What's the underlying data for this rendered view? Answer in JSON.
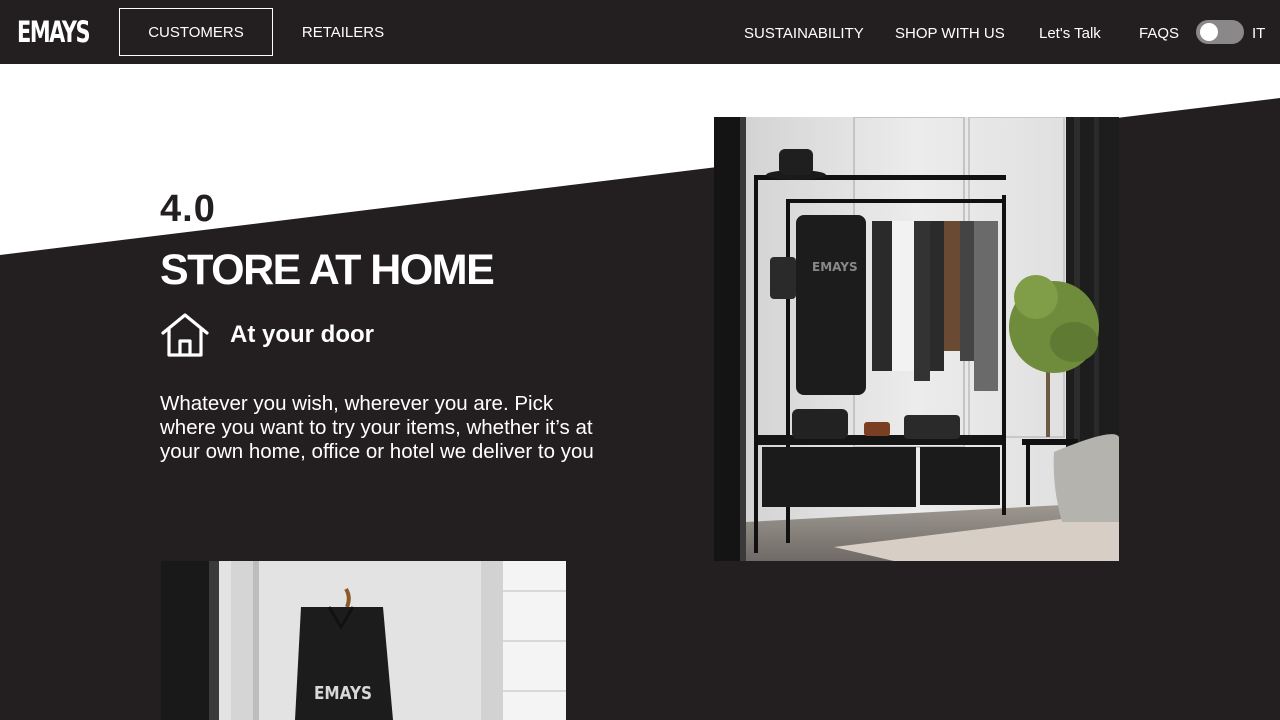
{
  "nav": {
    "logo": "EMAYS",
    "tabs": [
      {
        "label": "CUSTOMERS",
        "active": true
      },
      {
        "label": "RETAILERS",
        "active": false
      }
    ],
    "links": [
      "SUSTAINABILITY",
      "SHOP WITH US",
      "Let's Talk",
      "FAQS"
    ],
    "language_toggle": {
      "label": "IT",
      "on": false
    }
  },
  "section": {
    "number": "4.0",
    "title": "STORE AT HOME",
    "feature": {
      "icon": "house-icon",
      "label": "At your door"
    },
    "description": "Whatever you wish, wherever you are. Pick where you want to try your items, whether it’s at your own home, office or hotel we deliver to you"
  },
  "images": {
    "wardrobe_photo": {
      "brand_mark": "EMAYS"
    },
    "door_photo": {
      "brand_mark": "EMAYS"
    }
  },
  "colors": {
    "background": "#231f20",
    "band": "#ffffff",
    "text_light": "#ffffff",
    "text_dark": "#231f20",
    "toggle_track": "#8a8889"
  }
}
